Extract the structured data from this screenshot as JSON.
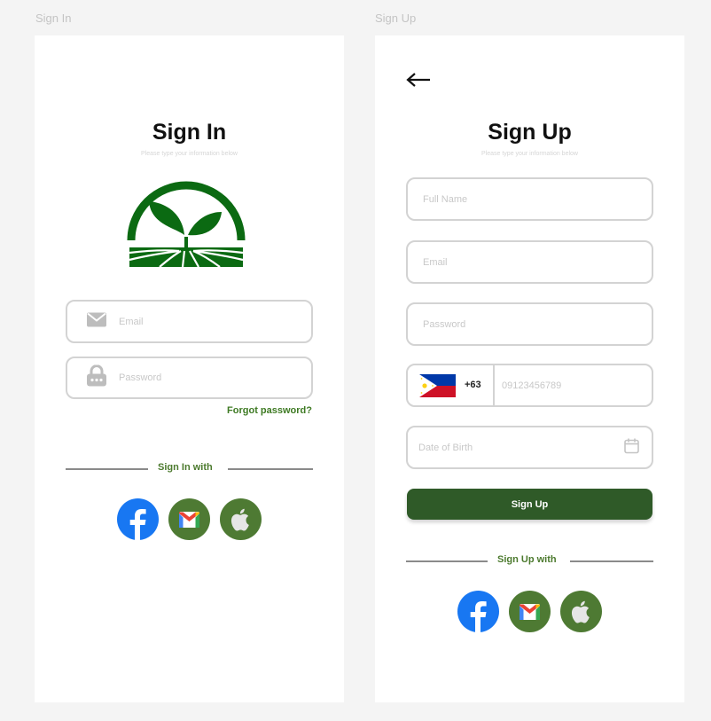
{
  "frames": {
    "signin_label": "Sign In",
    "signup_label": "Sign Up"
  },
  "signin": {
    "title": "Sign In",
    "subtitle": "Please type your information below",
    "email_placeholder": "Email",
    "password_placeholder": "Password",
    "forgot_password": "Forgot password?",
    "social_divider": "Sign In with",
    "logo_icon": "leaf-sprout-field-logo"
  },
  "signup": {
    "back_icon": "arrow-left-icon",
    "title": "Sign Up",
    "subtitle": "Please type your information below",
    "fullname_placeholder": "Full Name",
    "email_placeholder": "Email",
    "password_placeholder": "Password",
    "country_code": "+63",
    "phone_placeholder": "09123456789",
    "dob_placeholder": "Date of Birth",
    "submit_label": "Sign Up",
    "social_divider": "Sign Up with"
  },
  "social": [
    "facebook-icon",
    "gmail-icon",
    "apple-icon"
  ],
  "colors": {
    "brand_green": "#0b6a12",
    "accent_green": "#3e7a23",
    "button_green": "#2f5a28",
    "social_bg_green": "#4e7a33",
    "facebook_blue": "#1877f2"
  }
}
